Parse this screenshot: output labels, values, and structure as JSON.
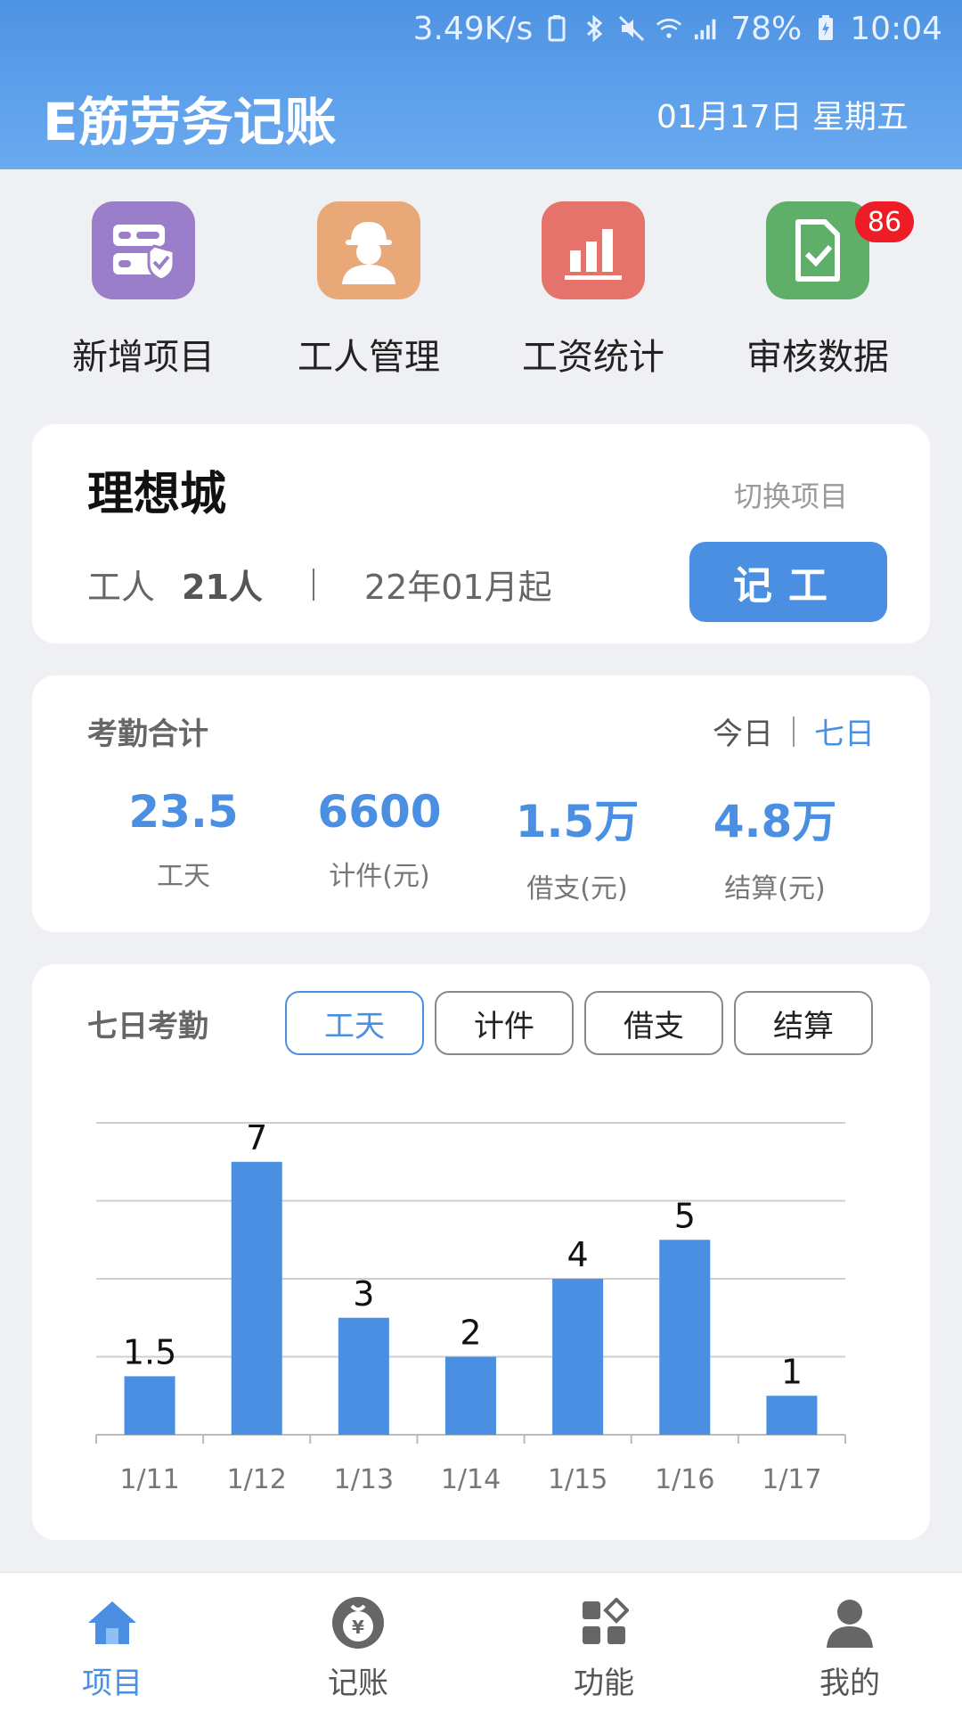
{
  "status_bar": {
    "speed": "3.49K/s",
    "battery": "78%",
    "time": "10:04"
  },
  "header": {
    "app_title": "E筋劳务记账",
    "date": "01月17日 星期五"
  },
  "quick_actions": [
    {
      "label": "新增项目",
      "icon": "server-shield-icon",
      "color": "#9b7ec9"
    },
    {
      "label": "工人管理",
      "icon": "worker-icon",
      "color": "#e9a878"
    },
    {
      "label": "工资统计",
      "icon": "bar-chart-icon",
      "color": "#e6736b"
    },
    {
      "label": "审核数据",
      "icon": "document-check-icon",
      "color": "#5fae6a",
      "badge": "86"
    }
  ],
  "project": {
    "name": "理想城",
    "switch_label": "切换项目",
    "workers_label": "工人",
    "workers_count": "21人",
    "start_label": "22年01月起",
    "record_button": "记工"
  },
  "attendance": {
    "title": "考勤合计",
    "range_today": "今日",
    "range_week": "七日",
    "stats": [
      {
        "value": "23.5",
        "label": "工天"
      },
      {
        "value": "6600",
        "label": "计件(元)"
      },
      {
        "value": "1.5万",
        "label": "借支(元)"
      },
      {
        "value": "4.8万",
        "label": "结算(元)"
      }
    ]
  },
  "weekly": {
    "title": "七日考勤",
    "tabs": [
      "工天",
      "计件",
      "借支",
      "结算"
    ],
    "active_tab": 0
  },
  "chart_data": {
    "type": "bar",
    "categories": [
      "1/11",
      "1/12",
      "1/13",
      "1/14",
      "1/15",
      "1/16",
      "1/17"
    ],
    "values": [
      1.5,
      7,
      3,
      2,
      4,
      5,
      1
    ],
    "value_labels": [
      "1.5",
      "7",
      "3",
      "2",
      "4",
      "5",
      "1"
    ],
    "ylim": [
      0,
      8
    ],
    "grid": true,
    "bar_color": "#4a8fe2"
  },
  "bottom_nav": [
    {
      "label": "项目",
      "icon": "home-icon",
      "active": true
    },
    {
      "label": "记账",
      "icon": "money-bag-icon",
      "active": false
    },
    {
      "label": "功能",
      "icon": "apps-icon",
      "active": false
    },
    {
      "label": "我的",
      "icon": "user-icon",
      "active": false
    }
  ],
  "colors": {
    "accent": "#4a8fe2",
    "badge": "#ee1c25"
  }
}
